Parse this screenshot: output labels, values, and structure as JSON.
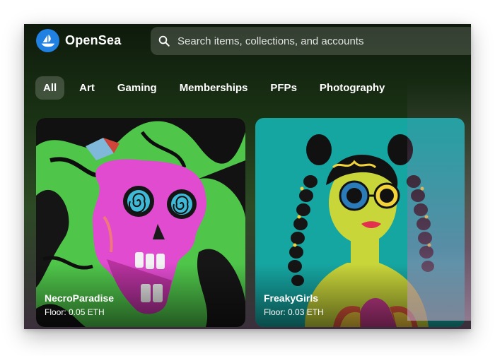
{
  "brand": {
    "name": "OpenSea",
    "logo_icon": "sailboat-icon",
    "logo_color": "#2081e2"
  },
  "search": {
    "placeholder": "Search items, collections, and accounts",
    "icon": "search-icon"
  },
  "tabs": [
    {
      "label": "All",
      "active": true
    },
    {
      "label": "Art"
    },
    {
      "label": "Gaming"
    },
    {
      "label": "Memberships"
    },
    {
      "label": "PFPs"
    },
    {
      "label": "Photography"
    }
  ],
  "cards": [
    {
      "title": "NecroParadise",
      "floor": "Floor: 0.05 ETH",
      "art": "pink-skull-artwork"
    },
    {
      "title": "FreakyGirls",
      "floor": "Floor: 0.03 ETH",
      "art": "girl-with-braids-artwork"
    }
  ]
}
